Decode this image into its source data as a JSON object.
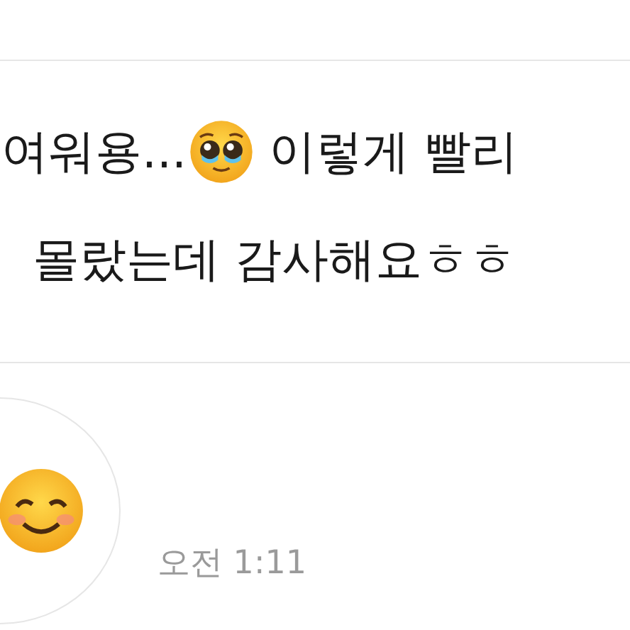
{
  "messages": [
    {
      "kind": "text",
      "line_1_start": "여워용...",
      "line_1_end": "이렇게 빨리",
      "line_2": "몰랐는데 감사해요ㅎㅎ"
    },
    {
      "kind": "emoji",
      "time": "오전 1:11"
    }
  ]
}
